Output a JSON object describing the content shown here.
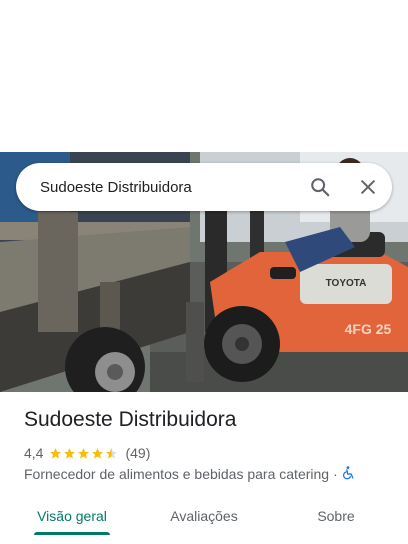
{
  "search": {
    "query": "Sudoeste Distribuidora",
    "search_icon": "search-icon",
    "close_icon": "close-icon"
  },
  "place": {
    "name": "Sudoeste Distribuidora",
    "rating": "4,4",
    "rating_value": 4.4,
    "review_count": "(49)",
    "category": "Fornecedor de alimentos e bebidas para catering",
    "separator": "·",
    "accessibility_icon": "wheelchair-icon",
    "photo_text": {
      "forklift_brand": "TOYOTA",
      "forklift_model": "4FG 25"
    }
  },
  "tabs": [
    {
      "label": "Visão geral",
      "active": true
    },
    {
      "label": "Avaliações",
      "active": false
    },
    {
      "label": "Sobre",
      "active": false
    }
  ],
  "colors": {
    "accent": "#00796b",
    "star": "#fbbc04",
    "accessibility": "#1a73e8"
  }
}
